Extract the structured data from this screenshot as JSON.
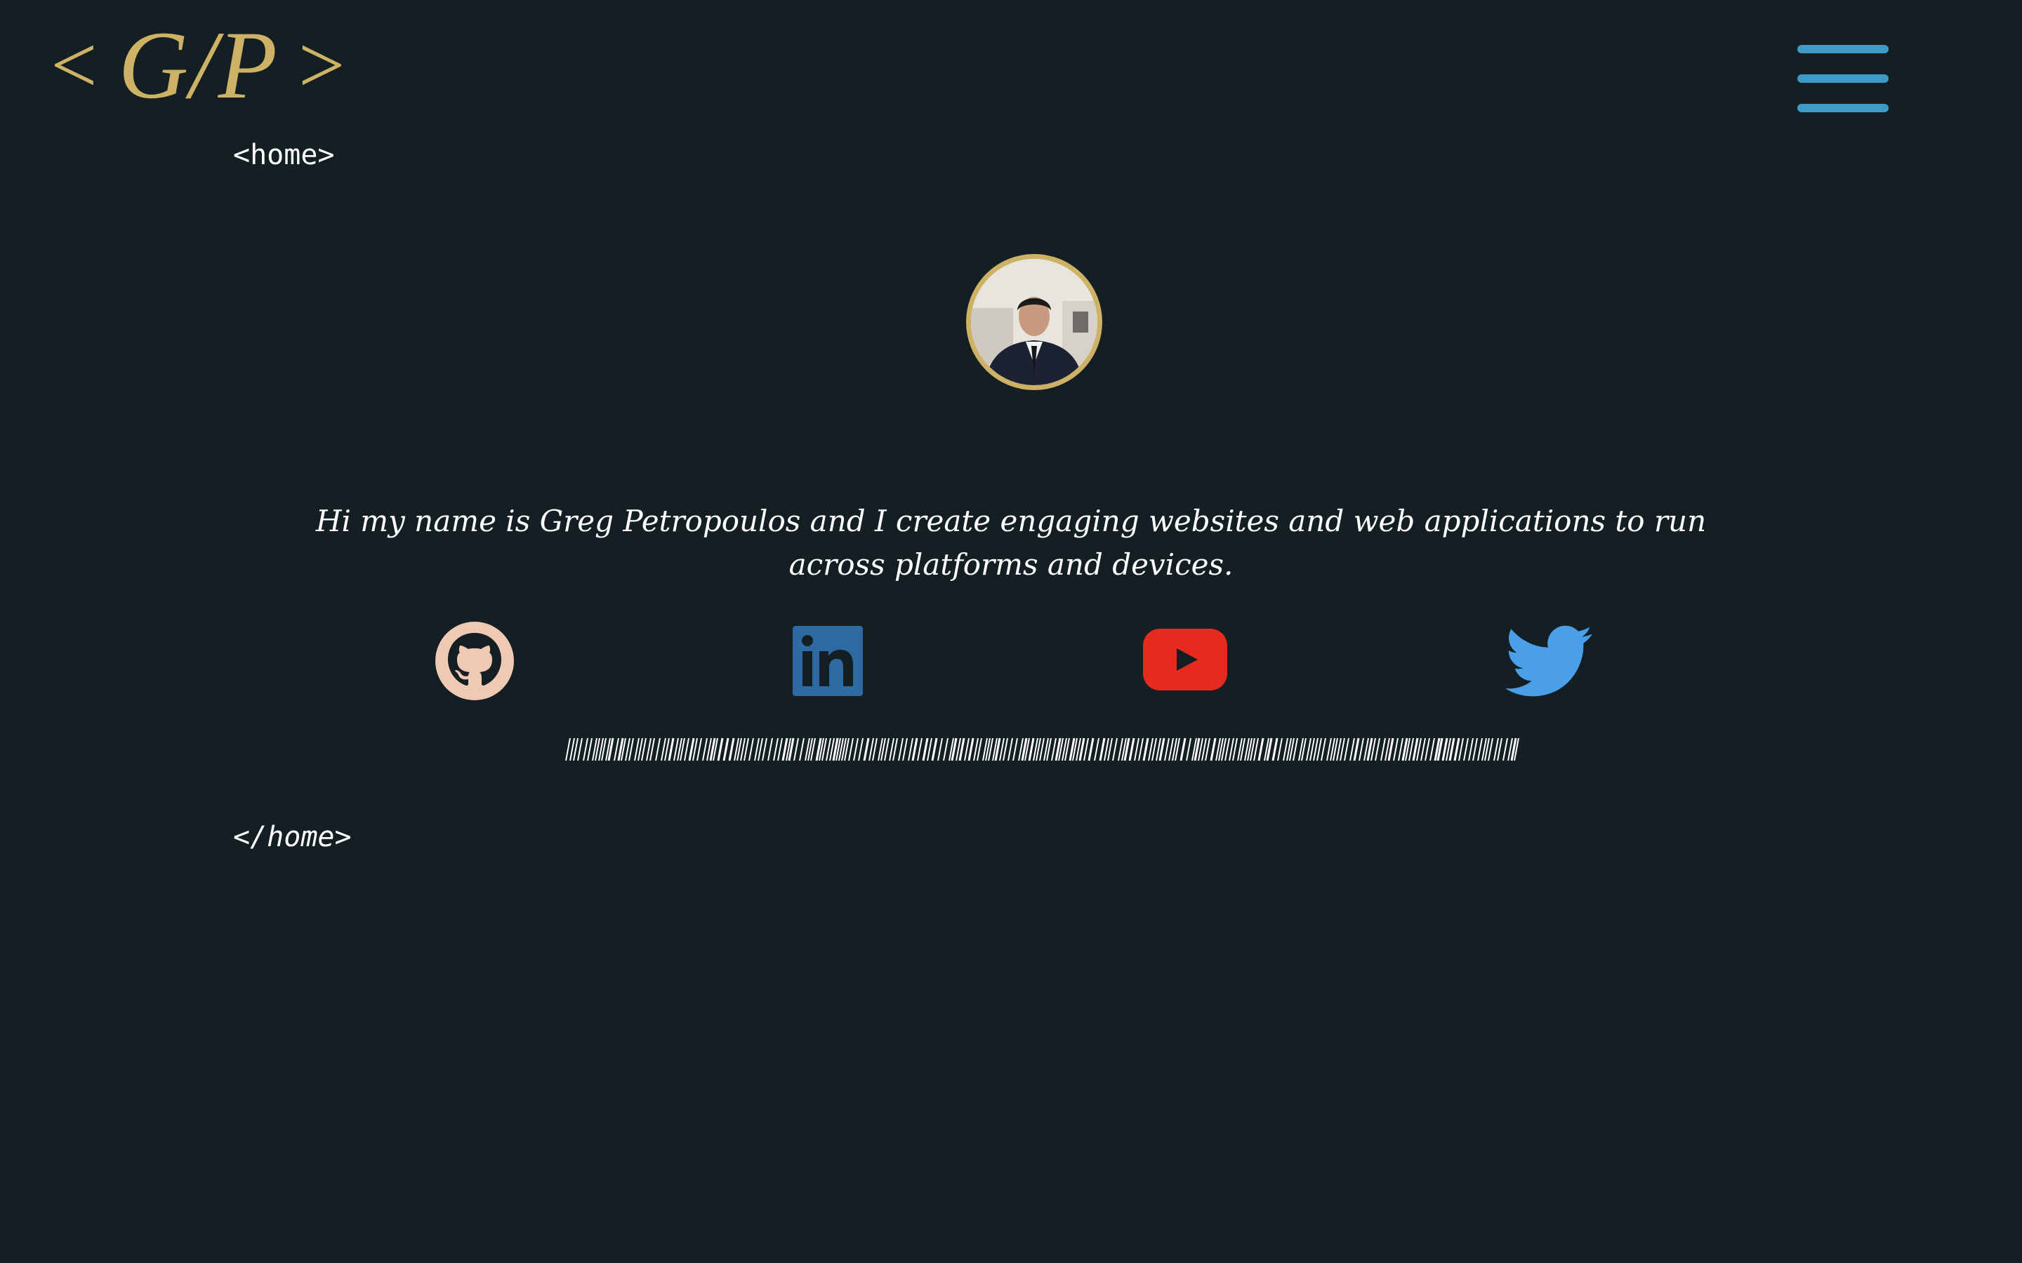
{
  "header": {
    "logo": {
      "open": "<",
      "initials": "G/P",
      "close": ">"
    },
    "menu_icon": "hamburger-menu-icon"
  },
  "section": {
    "open_tag": "<home>",
    "close_tag": "</home>"
  },
  "intro": {
    "text": "Hi my name is Greg Petropoulos and I create engaging websites and web applications to run across platforms and devices."
  },
  "social": [
    {
      "icon": "github-icon",
      "color": "#f0c9b3"
    },
    {
      "icon": "linkedin-icon",
      "color": "#2e6aa1"
    },
    {
      "icon": "youtube-icon",
      "color": "#e62b1e"
    },
    {
      "icon": "twitter-icon",
      "color": "#4a9fe8"
    }
  ],
  "colors": {
    "background": "#141f24",
    "accent_gold": "#cdb265",
    "menu_blue": "#3d9bc8",
    "text": "#ffffff"
  }
}
